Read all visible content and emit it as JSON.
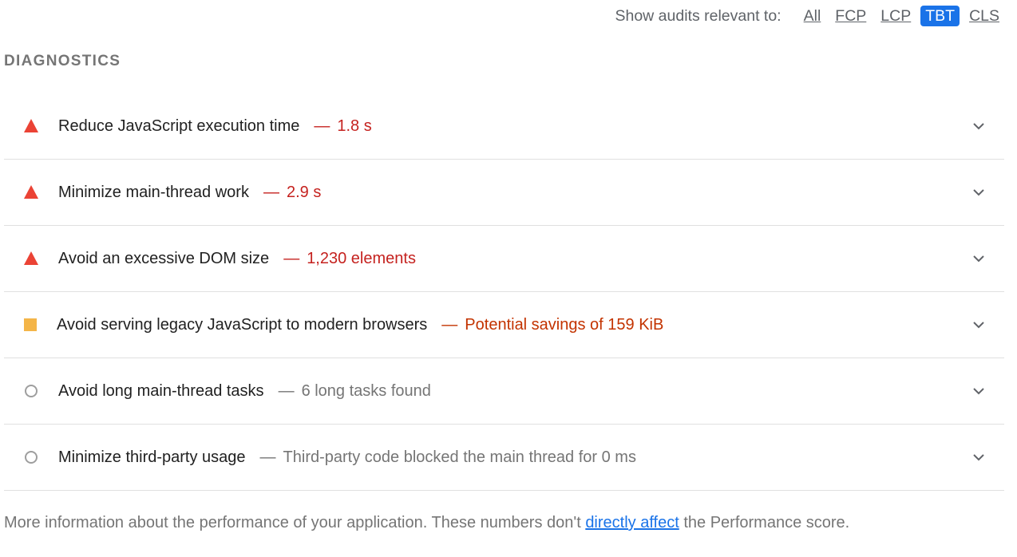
{
  "filter": {
    "label": "Show audits relevant to:",
    "options": [
      "All",
      "FCP",
      "LCP",
      "TBT",
      "CLS"
    ],
    "active": "TBT"
  },
  "section_title": "DIAGNOSTICS",
  "audits": [
    {
      "icon": "fail-triangle-icon",
      "title": "Reduce JavaScript execution time",
      "value": "1.8 s",
      "status": "fail",
      "separator": "—"
    },
    {
      "icon": "fail-triangle-icon",
      "title": "Minimize main-thread work",
      "value": "2.9 s",
      "status": "fail",
      "separator": "—"
    },
    {
      "icon": "fail-triangle-icon",
      "title": "Avoid an excessive DOM size",
      "value": "1,230 elements",
      "status": "fail",
      "separator": "—"
    },
    {
      "icon": "average-square-icon",
      "title": "Avoid serving legacy JavaScript to modern browsers",
      "value": "Potential savings of 159 KiB",
      "status": "average",
      "separator": "—"
    },
    {
      "icon": "informative-circle-icon",
      "title": "Avoid long main-thread tasks",
      "value": "6 long tasks found",
      "status": "info",
      "separator": "—"
    },
    {
      "icon": "informative-circle-icon",
      "title": "Minimize third-party usage",
      "value": "Third-party code blocked the main thread for 0 ms",
      "status": "info",
      "separator": "—"
    }
  ],
  "footer": {
    "text_before": "More information about the performance of your application. These numbers don't ",
    "link_text": "directly affect",
    "text_after": " the Performance score."
  },
  "colors": {
    "fail": "#c5221f",
    "fail_icon": "#eb4335",
    "average": "#c33300",
    "average_icon": "#f4b548",
    "info": "#757575",
    "accent": "#1a73e8"
  }
}
